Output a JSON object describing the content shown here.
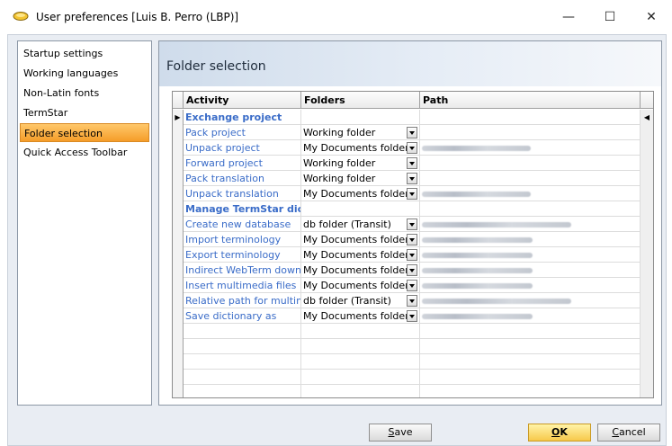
{
  "window": {
    "title": "User preferences [Luis B. Perro (LBP)]",
    "minimize": "—",
    "maximize": "☐",
    "close": "✕"
  },
  "sidebar": {
    "items": [
      {
        "label": "Startup settings",
        "active": false
      },
      {
        "label": "Working languages",
        "active": false
      },
      {
        "label": "Non-Latin fonts",
        "active": false
      },
      {
        "label": "TermStar",
        "active": false
      },
      {
        "label": "Folder selection",
        "active": true
      },
      {
        "label": "Quick Access Toolbar",
        "active": false
      }
    ]
  },
  "panel": {
    "title": "Folder selection",
    "columns": [
      "Activity",
      "Folders",
      "Path"
    ],
    "rows": [
      {
        "activity": "Exchange project",
        "folder": "",
        "group": true,
        "dropdown": false,
        "path_blurred": false,
        "width": 0
      },
      {
        "activity": "Pack project",
        "folder": "Working folder",
        "group": false,
        "dropdown": true,
        "path_blurred": false,
        "width": 0
      },
      {
        "activity": "Unpack project",
        "folder": "My Documents folder",
        "group": false,
        "dropdown": true,
        "path_blurred": true,
        "width": 0.68
      },
      {
        "activity": "Forward project",
        "folder": "Working folder",
        "group": false,
        "dropdown": true,
        "path_blurred": false,
        "width": 0
      },
      {
        "activity": "Pack translation",
        "folder": "Working folder",
        "group": false,
        "dropdown": true,
        "path_blurred": false,
        "width": 0
      },
      {
        "activity": "Unpack translation",
        "folder": "My Documents folder",
        "group": false,
        "dropdown": true,
        "path_blurred": true,
        "width": 0.68
      },
      {
        "activity": "Manage TermStar dictio",
        "folder": "",
        "group": true,
        "dropdown": false,
        "path_blurred": false,
        "width": 0
      },
      {
        "activity": "Create new database",
        "folder": "db folder (Transit)",
        "group": false,
        "dropdown": true,
        "path_blurred": true,
        "width": 0.93
      },
      {
        "activity": "Import terminology",
        "folder": "My Documents folder",
        "group": false,
        "dropdown": true,
        "path_blurred": true,
        "width": 0.69
      },
      {
        "activity": "Export terminology",
        "folder": "My Documents folder",
        "group": false,
        "dropdown": true,
        "path_blurred": true,
        "width": 0.69
      },
      {
        "activity": "Indirect WebTerm downlc",
        "folder": "My Documents folder",
        "group": false,
        "dropdown": true,
        "path_blurred": true,
        "width": 0.69
      },
      {
        "activity": "Insert multimedia files",
        "folder": "My Documents folder",
        "group": false,
        "dropdown": true,
        "path_blurred": true,
        "width": 0.69
      },
      {
        "activity": "Relative path for multime",
        "folder": "db folder (Transit)",
        "group": false,
        "dropdown": true,
        "path_blurred": true,
        "width": 0.93
      },
      {
        "activity": "Save dictionary as",
        "folder": "My Documents folder",
        "group": false,
        "dropdown": true,
        "path_blurred": true,
        "width": 0.69
      }
    ],
    "empty_rows": 5
  },
  "buttons": {
    "save": {
      "pre": "",
      "ul": "S",
      "post": "ave"
    },
    "ok": {
      "pre": "",
      "ul": "O",
      "post": "K"
    },
    "cancel": {
      "pre": "",
      "ul": "C",
      "post": "ancel"
    }
  },
  "colors": {
    "accent_selected": "#f59d29",
    "link_text": "#3a6cc8",
    "ok_button": "#f7c94b"
  }
}
